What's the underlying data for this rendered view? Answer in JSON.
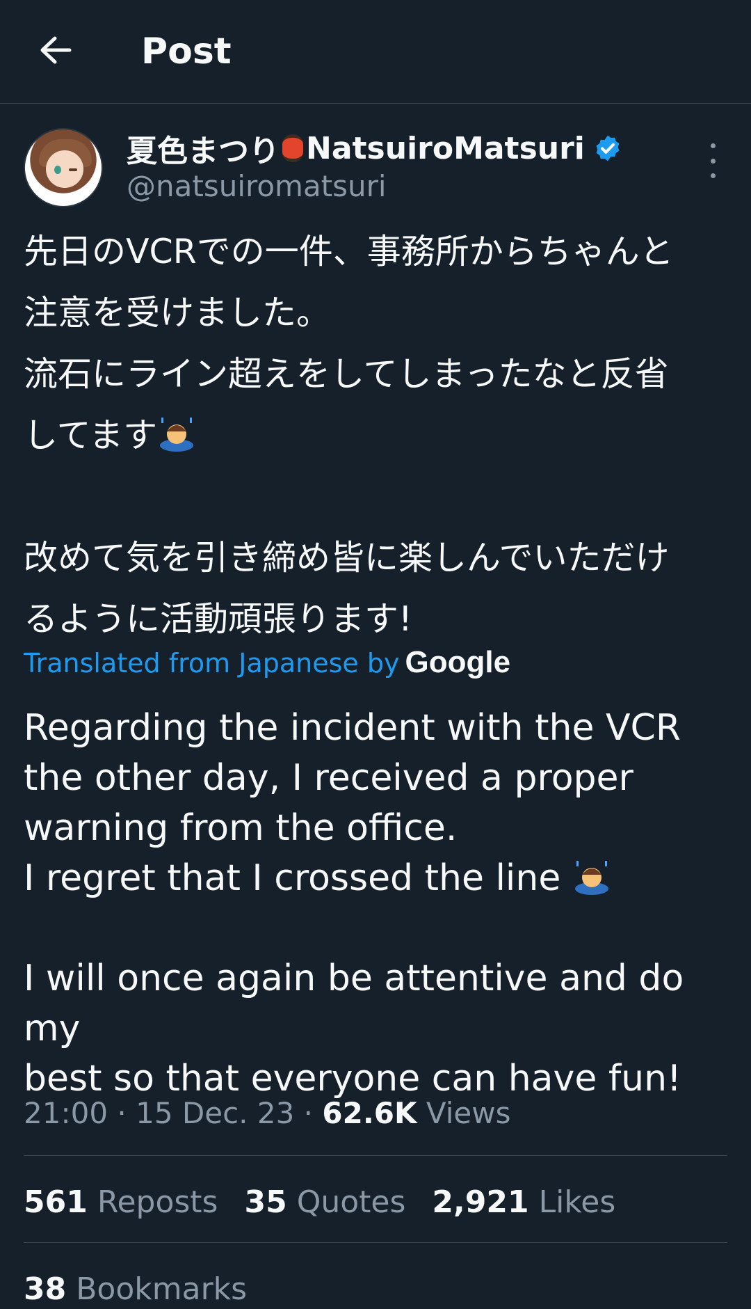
{
  "header": {
    "title": "Post"
  },
  "author": {
    "name_jp": "夏色まつり",
    "name_en": "NatsuiroMatsuri",
    "handle": "@natsuiromatsuri",
    "verified_color": "#1d9bf0"
  },
  "post": {
    "jp_text": "先日のVCRでの一件、事務所からちゃんと\n注意を受けました。\n流石にライン超えをしてしまったなと反省\nしてます",
    "jp_text_2": "改めて気を引き締め皆に楽しんでいただけ\nるように活動頑張ります!",
    "translated_label": "Translated from Japanese by",
    "translator": "Google",
    "en_text_1": "Regarding the incident with the VCR\nthe other day, I received a proper\nwarning from the office.\nI regret that I crossed the line ",
    "en_text_2": "I will once again be attentive and do my\nbest so that everyone can have fun!",
    "time": "21:00",
    "date": "15 Dec. 23",
    "views_count": "62.6K",
    "views_label": "Views"
  },
  "stats": {
    "reposts_count": "561",
    "reposts_label": "Reposts",
    "quotes_count": "35",
    "quotes_label": "Quotes",
    "likes_count": "2,921",
    "likes_label": "Likes",
    "bookmarks_count": "38",
    "bookmarks_label": "Bookmarks"
  },
  "icons": {
    "back": "arrow-left-icon",
    "more": "more-vertical-icon",
    "verified": "verified-badge-icon",
    "emoji_lantern": "red-lantern-emoji",
    "emoji_bow": "person-bowing-emoji"
  }
}
